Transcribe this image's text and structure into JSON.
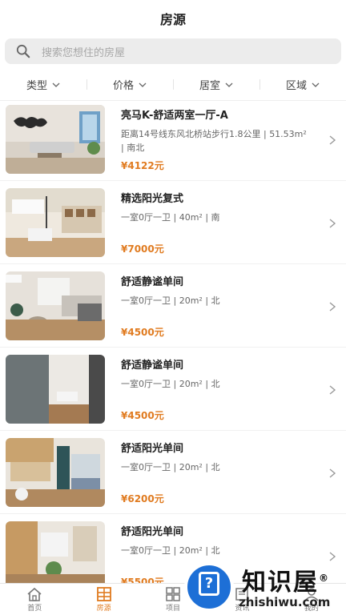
{
  "header": {
    "title": "房源"
  },
  "search": {
    "placeholder": "搜索您想住的房屋",
    "icon": "search-icon"
  },
  "filters": [
    {
      "label": "类型"
    },
    {
      "label": "价格"
    },
    {
      "label": "居室"
    },
    {
      "label": "区域"
    }
  ],
  "listings": [
    {
      "name": "亮马K-舒适两室一厅-A",
      "desc": "距离14号线东风北桥站步行1.8公里 | 51.53m² | 南北",
      "price": "¥4122元"
    },
    {
      "name": "精选阳光复式",
      "desc": "一室0厅一卫 | 40m² | 南",
      "price": "¥7000元"
    },
    {
      "name": "舒适静谧单间",
      "desc": "一室0厅一卫 | 20m² | 北",
      "price": "¥4500元"
    },
    {
      "name": "舒适静谧单间",
      "desc": "一室0厅一卫 | 20m² | 北",
      "price": "¥4500元"
    },
    {
      "name": "舒适阳光单间",
      "desc": "一室0厅一卫 | 20m² | 北",
      "price": "¥6200元"
    },
    {
      "name": "舒适阳光单间",
      "desc": "一室0厅一卫 | 20m² | 北",
      "price": "¥5500元"
    }
  ],
  "tabbar": [
    {
      "label": "首页",
      "icon": "home-icon",
      "active": false
    },
    {
      "label": "房源",
      "icon": "building-icon",
      "active": true
    },
    {
      "label": "项目",
      "icon": "grid-icon",
      "active": false
    },
    {
      "label": "资讯",
      "icon": "news-icon",
      "active": false
    },
    {
      "label": "我的",
      "icon": "user-icon",
      "active": false
    }
  ],
  "watermark": {
    "text": "知识屋",
    "url": "zhishiwu.com",
    "mark": "®"
  },
  "colors": {
    "accent": "#e07b20",
    "watermark_blue": "#1d6fd6"
  }
}
